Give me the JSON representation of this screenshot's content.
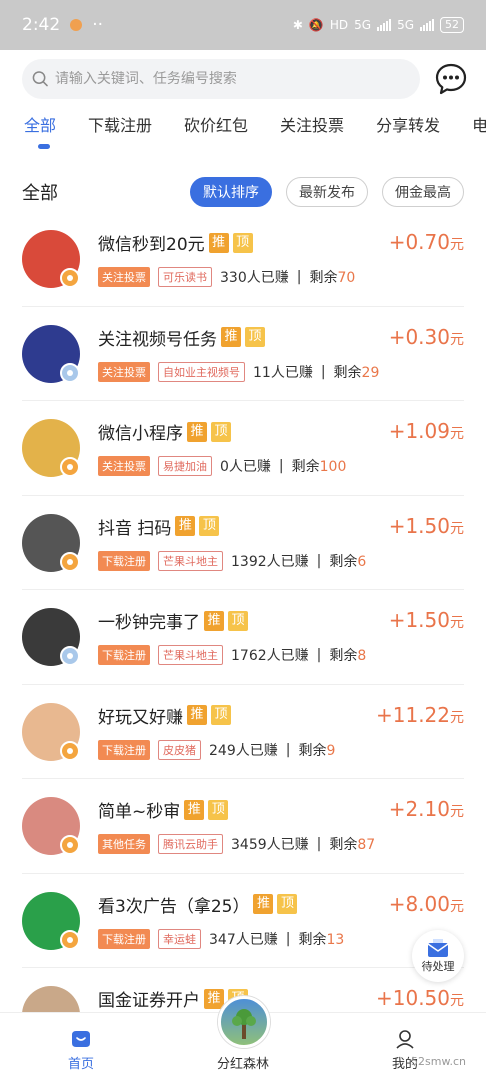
{
  "status": {
    "time": "2:42",
    "signal1": "5G",
    "signal2": "5G",
    "battery": "52"
  },
  "search": {
    "placeholder": "请输入关键词、任务编号搜索"
  },
  "tabs": [
    "全部",
    "下载注册",
    "砍价红包",
    "关注投票",
    "分享转发",
    "电"
  ],
  "section": {
    "title": "全部",
    "sort": [
      "默认排序",
      "最新发布",
      "佣金最高"
    ]
  },
  "tasks": [
    {
      "title": "微信秒到20元",
      "category": "关注投票",
      "publisher": "可乐读书",
      "earned": "330人已赚",
      "sep": "|",
      "remain_label": "剩余",
      "remain": "70",
      "price": "+0.70",
      "unit": "元",
      "avatar": "qr-avatar",
      "color": "#d94a3a"
    },
    {
      "title": "关注视频号任务",
      "category": "关注投票",
      "publisher": "自如业主视频号",
      "earned": "11人已赚",
      "sep": "|",
      "remain_label": "剩余",
      "remain": "29",
      "price": "+0.30",
      "unit": "元",
      "avatar": "calligraphy-avatar",
      "color": "#2e3b8f"
    },
    {
      "title": "微信小程序",
      "category": "关注投票",
      "publisher": "易捷加油",
      "earned": "0人已赚",
      "sep": "|",
      "remain_label": "剩余",
      "remain": "100",
      "price": "+1.09",
      "unit": "元",
      "avatar": "cartoon-avatar",
      "color": "#e3b24a"
    },
    {
      "title": "抖音 扫码",
      "category": "下载注册",
      "publisher": "芒果斗地主",
      "earned": "1392人已赚",
      "sep": "|",
      "remain_label": "剩余",
      "remain": "6",
      "price": "+1.50",
      "unit": "元",
      "avatar": "person-avatar",
      "color": "#555555"
    },
    {
      "title": "一秒钟完事了",
      "category": "下载注册",
      "publisher": "芒果斗地主",
      "earned": "1762人已赚",
      "sep": "|",
      "remain_label": "剩余",
      "remain": "8",
      "price": "+1.50",
      "unit": "元",
      "avatar": "person-avatar",
      "color": "#3a3a3a"
    },
    {
      "title": "好玩又好赚",
      "category": "下载注册",
      "publisher": "皮皮猪",
      "earned": "249人已赚",
      "sep": "|",
      "remain_label": "剩余",
      "remain": "9",
      "price": "+11.22",
      "unit": "元",
      "avatar": "person-avatar",
      "color": "#e8b890"
    },
    {
      "title": "简单~秒审",
      "category": "其他任务",
      "publisher": "腾讯云助手",
      "earned": "3459人已赚",
      "sep": "|",
      "remain_label": "剩余",
      "remain": "87",
      "price": "+2.10",
      "unit": "元",
      "avatar": "person-avatar",
      "color": "#d98a80"
    },
    {
      "title": "看3次广告（拿25）",
      "category": "下载注册",
      "publisher": "幸运蛙",
      "earned": "347人已赚",
      "sep": "|",
      "remain_label": "剩余",
      "remain": "13",
      "price": "+8.00",
      "unit": "元",
      "avatar": "wechat-avatar",
      "color": "#2aa04a"
    },
    {
      "title": "国金证券开户",
      "category": "",
      "publisher": "",
      "earned": "",
      "sep": "",
      "remain_label": "",
      "remain": "",
      "price": "+10.50",
      "unit": "元",
      "avatar": "cat-avatar",
      "color": "#c9a889"
    }
  ],
  "tags": {
    "tui": "推",
    "ding": "顶"
  },
  "pending": {
    "label": "待处理"
  },
  "nav": {
    "home": "首页",
    "forest": "分红森林",
    "mine": "我的"
  },
  "watermark": "52smw.cn",
  "colors": {
    "accent": "#3a6fe0",
    "price": "#e9744a",
    "category_tag": "#f28a52"
  }
}
